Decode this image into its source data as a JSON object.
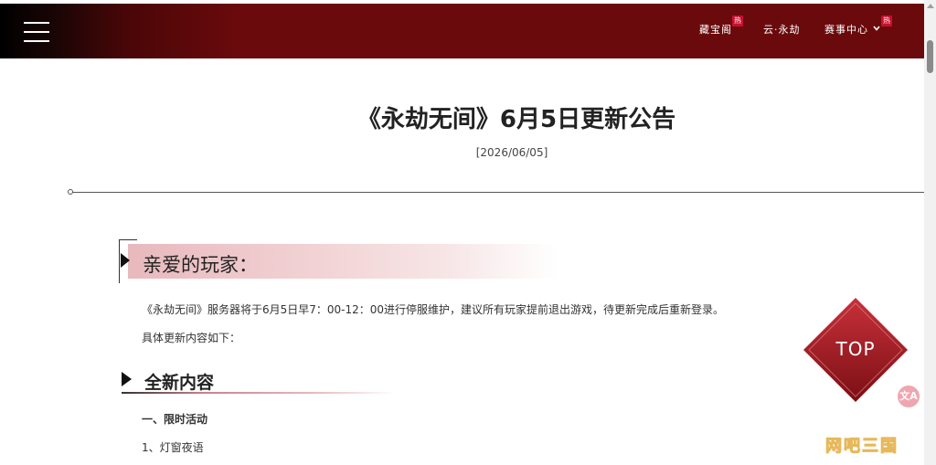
{
  "nav": {
    "vault_label": "藏宝阁",
    "cloud_label": "云·永劫",
    "events_label": "赛事中心",
    "hot_badge": "热"
  },
  "article": {
    "title": "《永劫无间》6月5日更新公告",
    "date": "[2026/06/05]",
    "greeting": "亲爱的玩家：",
    "paragraph1": "《永劫无间》服务器将于6月5日早7：00-12：00进行停服维护，建议所有玩家提前退出游戏，待更新完成后重新登录。",
    "paragraph2": "具体更新内容如下：",
    "section_title": "全新内容",
    "subsection": "一、限时活动",
    "item1": "1、灯窗夜语"
  },
  "top_button": {
    "label": "TOP"
  },
  "translate_icon": {
    "label": "文A"
  },
  "watermark": {
    "text": "网吧三国"
  },
  "colors": {
    "nav_bg": "#6a0a0c",
    "accent_pink": "#e8b9bd",
    "top_button": "#9e1b21",
    "badge": "#c8102e"
  }
}
